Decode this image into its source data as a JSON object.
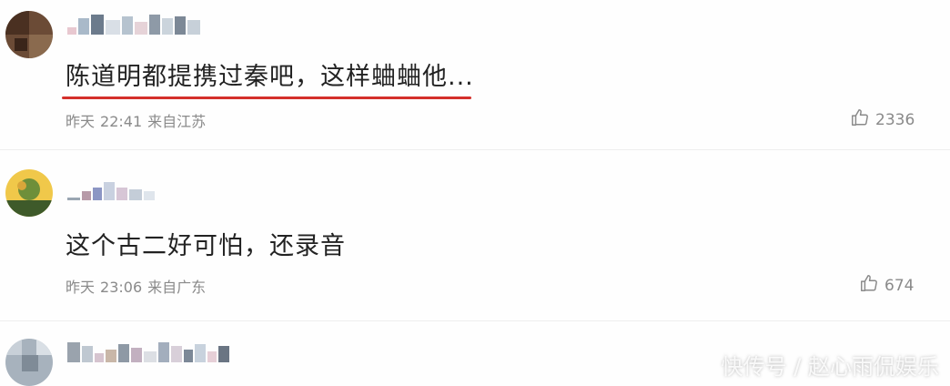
{
  "comments": [
    {
      "text": "陈道明都提携过秦吧，这样蛐蛐他...",
      "day": "昨天",
      "time": "22:41",
      "location": "来自江苏",
      "likes": "2336",
      "underline_color": "#d4302b"
    },
    {
      "text": "这个古二好可怕，还录音",
      "day": "昨天",
      "time": "23:06",
      "location": "来自广东",
      "likes": "674"
    }
  ],
  "watermark": "快传号 / 赵心雨侃娱乐",
  "colors": {
    "text": "#222222",
    "meta": "#8a8a8a",
    "underline": "#d4302b"
  },
  "icons": {
    "like": "thumbs-up-icon"
  }
}
